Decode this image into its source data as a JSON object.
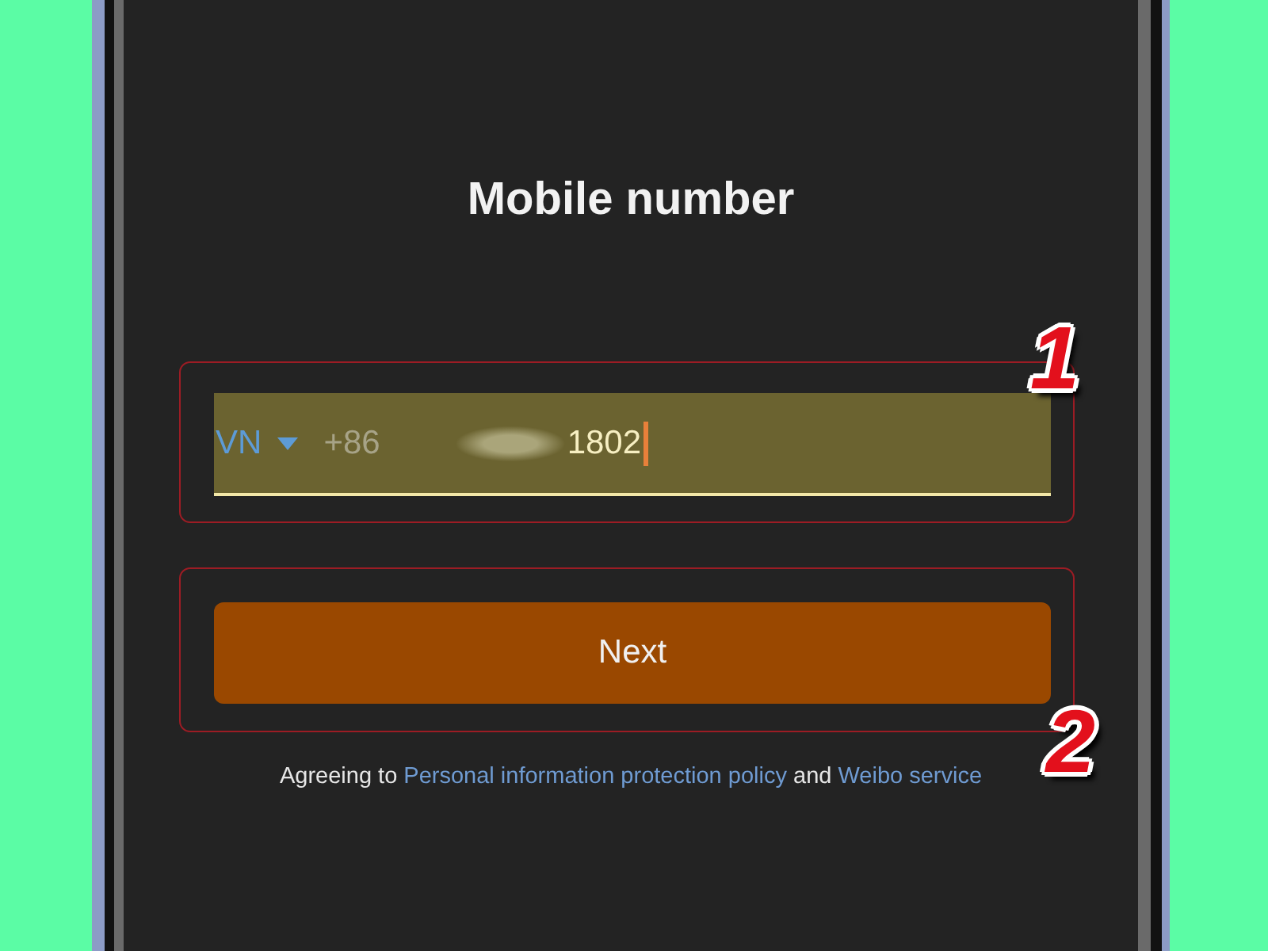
{
  "screen": {
    "title": "Mobile number"
  },
  "phone_field": {
    "country": "VN",
    "dial_code": "+86",
    "value": "1802",
    "value_blurred": true,
    "focused": true,
    "step_marker": "1"
  },
  "next_button": {
    "label": "Next",
    "step_marker": "2"
  },
  "agreement": [
    {
      "kind": "text",
      "text": "Agreeing to"
    },
    {
      "kind": "link",
      "text": "Personal information protection policy"
    },
    {
      "kind": "text",
      "text": "and"
    },
    {
      "kind": "link",
      "text": "Weibo service"
    }
  ]
}
